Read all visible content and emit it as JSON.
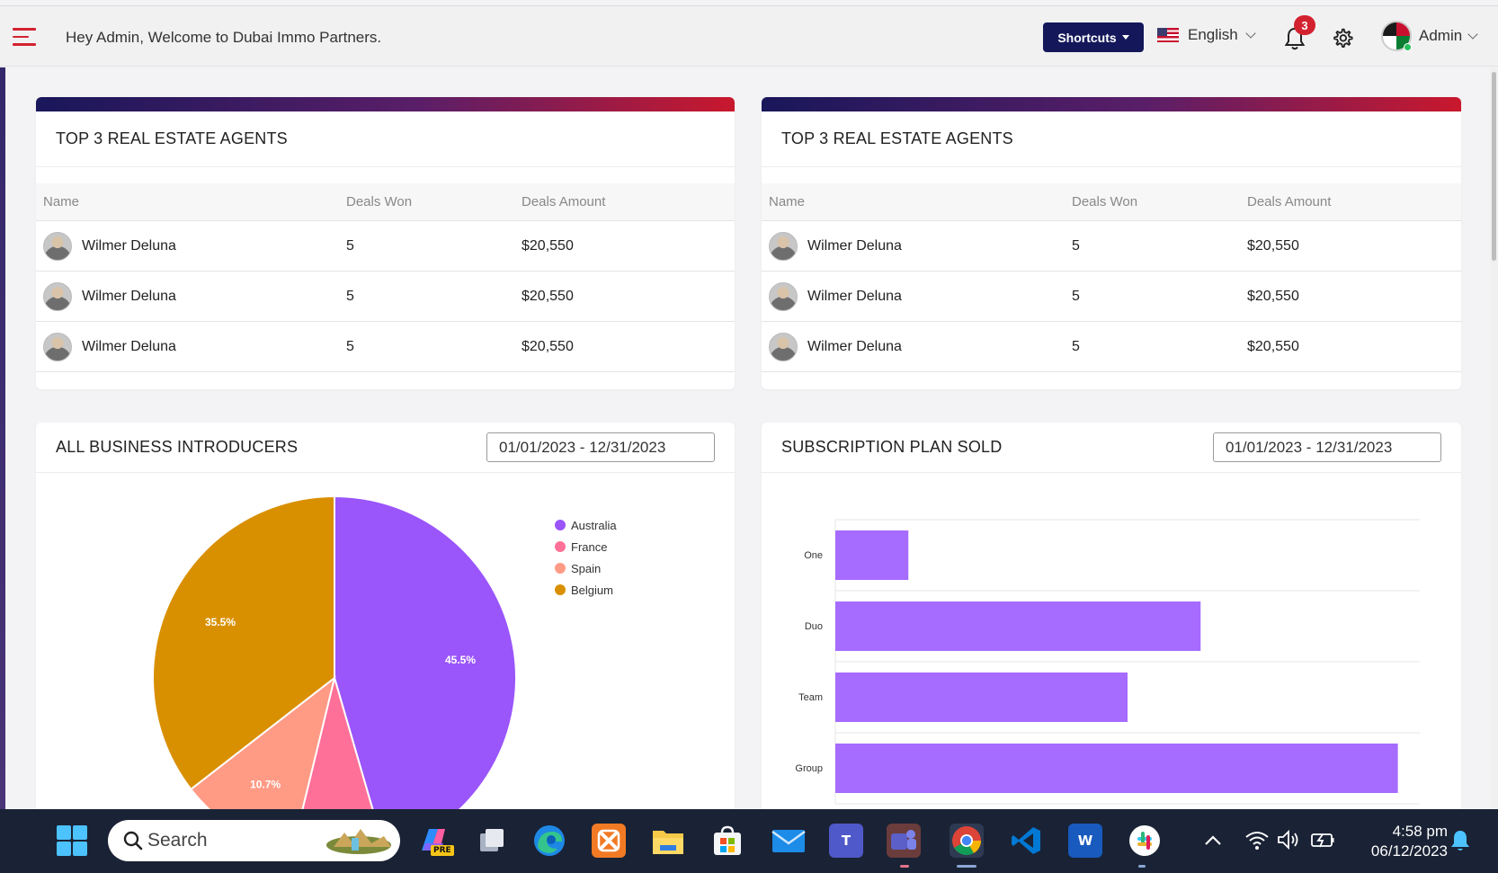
{
  "topbar": {
    "welcome": "Hey Admin, Welcome to Dubai Immo Partners.",
    "shortcuts_label": "Shortcuts",
    "language": "English",
    "notification_count": "3",
    "user_name": "Admin"
  },
  "agents_cards": [
    {
      "title": "TOP 3 REAL ESTATE AGENTS",
      "columns": [
        "Name",
        "Deals Won",
        "Deals Amount"
      ],
      "rows": [
        {
          "name": "Wilmer Deluna",
          "deals_won": "5",
          "amount": "$20,550"
        },
        {
          "name": "Wilmer Deluna",
          "deals_won": "5",
          "amount": "$20,550"
        },
        {
          "name": "Wilmer Deluna",
          "deals_won": "5",
          "amount": "$20,550"
        }
      ]
    },
    {
      "title": "TOP 3 REAL ESTATE AGENTS",
      "columns": [
        "Name",
        "Deals Won",
        "Deals Amount"
      ],
      "rows": [
        {
          "name": "Wilmer Deluna",
          "deals_won": "5",
          "amount": "$20,550"
        },
        {
          "name": "Wilmer Deluna",
          "deals_won": "5",
          "amount": "$20,550"
        },
        {
          "name": "Wilmer Deluna",
          "deals_won": "5",
          "amount": "$20,550"
        }
      ]
    }
  ],
  "introducers": {
    "title": "ALL BUSINESS INTRODUCERS",
    "date_range": "01/01/2023 - 12/31/2023"
  },
  "subscriptions": {
    "title": "SUBSCRIPTION PLAN SOLD",
    "date_range": "01/01/2023 - 12/31/2023"
  },
  "colors": {
    "australia": "#9a55fb",
    "france": "#ff7098",
    "spain": "#ff9a85",
    "belgium": "#d99000",
    "bars": "#a66bff",
    "brand_navy": "#14185a",
    "brand_red": "#d3222f"
  },
  "chart_data": [
    {
      "type": "pie",
      "categories": [
        "Australia",
        "France",
        "Spain",
        "Belgium"
      ],
      "values": [
        45.5,
        8.3,
        10.7,
        35.5
      ],
      "value_labels": [
        "45.5%",
        "",
        "10.7%",
        "35.5%"
      ],
      "legend": "top-right"
    },
    {
      "type": "bar",
      "orientation": "horizontal",
      "categories": [
        "One",
        "Duo",
        "Team",
        "Group"
      ],
      "values": [
        1,
        5,
        4,
        7.7
      ],
      "xlim": [
        0,
        8
      ],
      "grid": true
    }
  ],
  "taskbar": {
    "search_placeholder": "Search",
    "time": "4:58 pm",
    "date": "06/12/2023",
    "icons": [
      "windows-start",
      "copilot-pre",
      "task-view",
      "edge",
      "xampp",
      "file-explorer",
      "microsoft-store",
      "mail",
      "teams",
      "teams-work",
      "chrome",
      "vscode",
      "word",
      "slack"
    ],
    "copilot_badge": "PRE",
    "teams_letter": "T",
    "word_letter": "W"
  }
}
